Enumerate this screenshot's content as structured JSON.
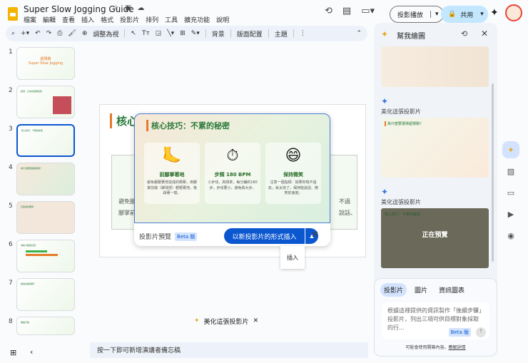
{
  "app": {
    "title": "Super Slow Jogging Guide",
    "menu": [
      "檔案",
      "編輯",
      "查看",
      "插入",
      "格式",
      "投影片",
      "排列",
      "工具",
      "擴充功能",
      "說明"
    ],
    "present": "投影播放",
    "share": "共用"
  },
  "toolbar": {
    "zoom": "調整為視",
    "background": "背景",
    "layout": "版面配置",
    "theme": "主題"
  },
  "filmstrip": {
    "slides": [
      {
        "num": "1",
        "title": "超慢跑",
        "subtitle": "Super Slow Jogging"
      },
      {
        "num": "2",
        "title": "起源：日本的健康秘密"
      },
      {
        "num": "3",
        "title": "核心技巧：不累的秘密"
      },
      {
        "num": "4",
        "title": "為什麼要選擇超慢跑？"
      },
      {
        "num": "5",
        "title": "正確姿勢要領"
      },
      {
        "num": "6",
        "title": "消耗卡路里比較"
      },
      {
        "num": "7",
        "title": "誰適合超慢跑？"
      },
      {
        "num": "8",
        "title": "開始行動"
      }
    ]
  },
  "slide": {
    "title": "核心",
    "left_text": "避免腳\n腳掌前",
    "right_text": "不過\n說話、"
  },
  "popup": {
    "preview_title": "核心技巧：不累的秘密",
    "cards": [
      {
        "icon": "🦶",
        "heading": "前腳掌著地",
        "text": "避免腳跟著地造成的衝擊，用腳掌前端（蹠球部）輕輕著地，像踩著一樣。"
      },
      {
        "icon": "⏱",
        "heading": "步頻 180 BPM",
        "text": "小步伐，高頻率，每分鐘約180步，步伐要小，避免跨大步。"
      },
      {
        "icon": "😄",
        "heading": "保持微笑",
        "text": "注意一個指標：如果你喘不過氣，就太快了，保持能說話、微笑的速度。"
      }
    ],
    "label": "投影片預覽",
    "beta": "Beta 版",
    "insert": "以新投影片的形式插入",
    "menu_insert": "插入"
  },
  "beautify": "美化這張投影片",
  "notes": "按一下即可新增演講者備忘稿",
  "panel": {
    "title": "幫我繪圖",
    "item_label_1": "美化這張投影片",
    "item_label_2": "美化這張投影片",
    "thumb2_title": "為什麼要選擇超慢跑？",
    "thumb3_title": "核心技巧：不累的秘密",
    "previewing": "正在預覽",
    "tabs": [
      "投影片",
      "圖片",
      "資訊圖表"
    ],
    "prompt": "根據這裡提供的資訊製作「後續步驟」投影片，列出三項可供目標對象採取的行...",
    "beta": "Beta 版",
    "footer": "可能會使用開箱內容。",
    "learn_more": "瞭解詳情"
  }
}
